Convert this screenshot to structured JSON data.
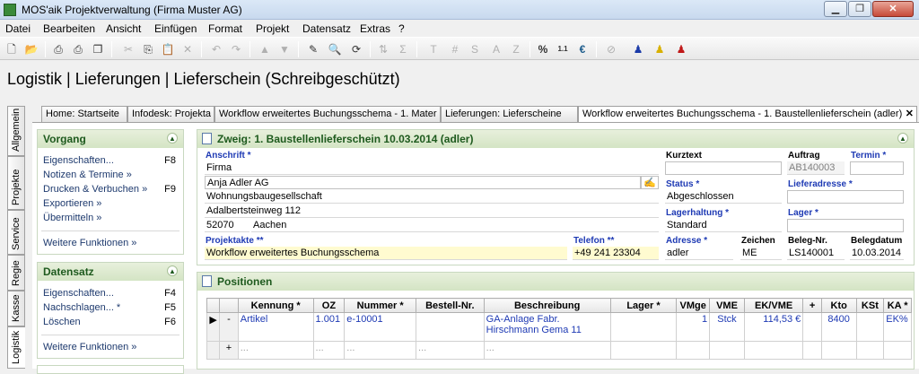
{
  "window": {
    "title": "MOS'aik Projektverwaltung (Firma Muster AG)"
  },
  "menu": [
    "Datei",
    "Bearbeiten",
    "Ansicht",
    "Einfügen",
    "Format",
    "Projekt",
    "Datensatz",
    "Extras",
    "?"
  ],
  "page_heading": "Logistik | Lieferungen | Lieferschein (Schreibgeschützt)",
  "tabs": [
    "Home: Startseite",
    "Infodesk: Projekta",
    "Workflow erweitertes Buchungsschema - 1. Mater",
    "Lieferungen: Lieferscheine",
    "Workflow erweitertes Buchungsschema - 1. Baustellenlieferschein (adler)"
  ],
  "vertical_tabs": [
    "Allgemein",
    "Projekte",
    "Service",
    "Regie",
    "Kasse",
    "Logistik"
  ],
  "vorgang": {
    "title": "Vorgang",
    "items": [
      {
        "label": "Eigenschaften...",
        "key": "F8"
      },
      {
        "label": "Notizen & Termine »",
        "key": ""
      },
      {
        "label": "Drucken & Verbuchen »",
        "key": "F9"
      },
      {
        "label": "Exportieren »",
        "key": ""
      },
      {
        "label": "Übermitteln »",
        "key": ""
      }
    ],
    "more": "Weitere Funktionen »"
  },
  "datensatz": {
    "title": "Datensatz",
    "items": [
      {
        "label": "Eigenschaften...",
        "key": "F4"
      },
      {
        "label": "Nachschlagen... *",
        "key": "F5"
      },
      {
        "label": "Löschen",
        "key": "F6"
      }
    ],
    "more": "Weitere Funktionen »"
  },
  "zweig": {
    "header": "Zweig: 1. Baustellenlieferschein 10.03.2014 (adler)",
    "anschrift_label": "Anschrift *",
    "anschrift": [
      "Firma",
      "Anja Adler AG",
      "Wohnungsbaugesellschaft",
      "Adalbertsteinweg 112"
    ],
    "plz": "52070",
    "ort": "Aachen",
    "projektakte_label": "Projektakte **",
    "projektakte": "Workflow erweitertes Buchungsschema",
    "telefon_label": "Telefon **",
    "telefon": "+49 241 23304",
    "kurztext_label": "Kurztext",
    "kurztext": "",
    "status_label": "Status *",
    "status": "Abgeschlossen",
    "lagerhaltung_label": "Lagerhaltung *",
    "lagerhaltung": "Standard",
    "adresse_label": "Adresse *",
    "adresse": "adler",
    "zeichen_label": "Zeichen",
    "zeichen": "ME",
    "beleg_nr_label": "Beleg-Nr.",
    "beleg_nr": "LS140001",
    "belegdatum_label": "Belegdatum",
    "belegdatum": "10.03.2014",
    "auftrag_label": "Auftrag",
    "auftrag": "AB140003",
    "termin_label": "Termin *",
    "termin": "",
    "lieferadresse_label": "Lieferadresse *",
    "lieferadresse": "",
    "lager_label": "Lager *",
    "lager": ""
  },
  "positionen": {
    "title": "Positionen",
    "columns": [
      "",
      "",
      "Kennung *",
      "OZ",
      "Nummer *",
      "Bestell-Nr.",
      "Beschreibung",
      "Lager *",
      "VMge",
      "VME",
      "EK/VME",
      "+",
      "Kto",
      "KSt",
      "KA *"
    ],
    "rows": [
      {
        "marker": "▶",
        "exp": "-",
        "kennung": "Artikel",
        "oz": "1.001",
        "nummer": "e-10001",
        "bestell": "",
        "beschreibung": "GA-Anlage Fabr.",
        "beschreibung2": "Hirschmann Gema 11",
        "lager": "",
        "vmge": "1",
        "vme": "Stck",
        "ek": "114,53 €",
        "plus": "",
        "kto": "8400",
        "kst": "",
        "ka": "EK%"
      },
      {
        "marker": "",
        "exp": "+",
        "kennung": "...",
        "oz": "...",
        "nummer": "...",
        "bestell": "...",
        "beschreibung": "...",
        "beschreibung2": "",
        "lager": "",
        "vmge": "",
        "vme": "",
        "ek": "",
        "plus": "",
        "kto": "",
        "kst": "",
        "ka": ""
      }
    ]
  },
  "colors": {
    "accent_green": "#1e5a1e",
    "label_blue": "#1e3ab4",
    "yellow_field": "#fffbd0"
  }
}
